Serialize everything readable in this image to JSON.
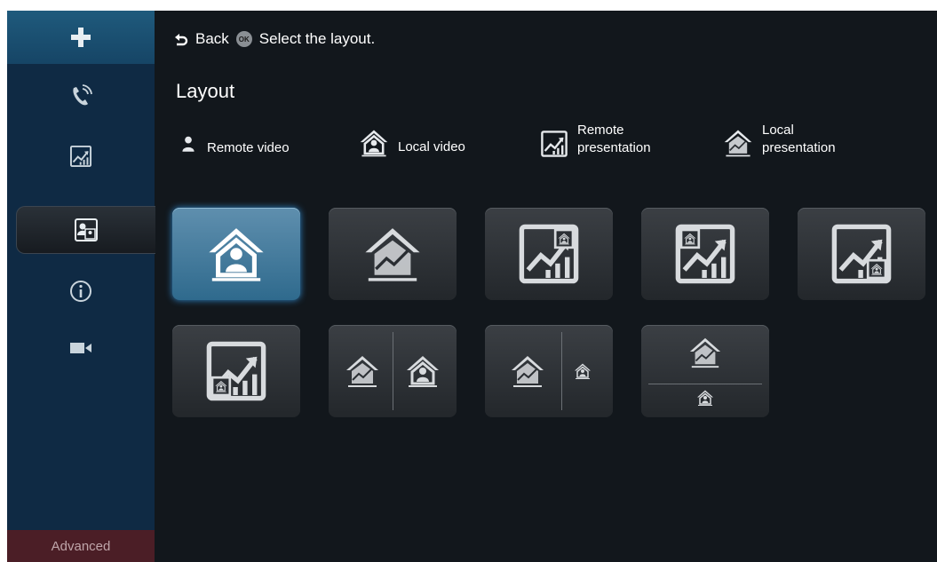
{
  "topbar": {
    "back_label": "Back",
    "ok_badge": "OK",
    "instruction": "Select the layout."
  },
  "title": "Layout",
  "legend": [
    {
      "icon": "person-icon",
      "label": "Remote video"
    },
    {
      "icon": "house-person-icon",
      "label": "Local video"
    },
    {
      "icon": "chart-frame-icon",
      "label": "Remote\npresentation"
    },
    {
      "icon": "house-chart-icon",
      "label": "Local\npresentation"
    }
  ],
  "sidebar": {
    "items": [
      "plus-icon",
      "phone-icon",
      "chart-icon",
      "layout-icon",
      "info-icon",
      "camera-icon"
    ],
    "active": "layout-icon",
    "advanced_label": "Advanced"
  },
  "layouts": [
    {
      "name": "local-video-full",
      "selected": true
    },
    {
      "name": "local-presentation-full",
      "selected": false
    },
    {
      "name": "remote-presentation-pip-top-right",
      "selected": false
    },
    {
      "name": "remote-presentation-pip-top-left",
      "selected": false
    },
    {
      "name": "remote-presentation-pip-bottom-right",
      "selected": false
    },
    {
      "name": "remote-presentation-pip-bottom-left",
      "selected": false
    },
    {
      "name": "local-presentation-local-video-split",
      "selected": false
    },
    {
      "name": "local-presentation-large-local-video-small",
      "selected": false
    },
    {
      "name": "local-presentation-top-local-video-bottom",
      "selected": false
    }
  ],
  "colors": {
    "sidebar": "#0f2a44",
    "background": "#12171c",
    "accent": "#2f6a8d",
    "advanced": "#4b1e26"
  }
}
